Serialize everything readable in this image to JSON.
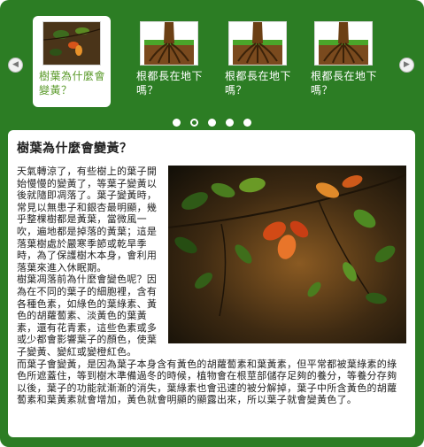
{
  "carousel": {
    "items": [
      {
        "caption": "樹葉為什麼會變黃？",
        "image": "autumn-leaves-thumbnail",
        "active": true
      },
      {
        "caption": "根都長在地下嗎？",
        "image": "tree-roots-thumbnail",
        "active": false
      },
      {
        "caption": "根都長在地下嗎？",
        "image": "tree-roots-thumbnail",
        "active": false
      },
      {
        "caption": "根都長在地下嗎？",
        "image": "tree-roots-thumbnail",
        "active": false
      }
    ],
    "prev_icon": "chevron-left-icon",
    "next_icon": "chevron-right-icon",
    "page_count": 5,
    "current_page": 2
  },
  "article": {
    "title": "樹葉為什麼會變黃？",
    "image": "autumn-leaves-photo",
    "paragraphs": [
      "天氣轉涼了，有些樹上的葉子開始慢慢的變黃了，等葉子變黃以後就隨即凋落了。葉子變黃時，常見以無患子和銀杏最明顯，幾乎整棵樹都是黃葉，當微風一吹，遍地都是掉落的黃葉；這是落葉樹處於嚴寒季節或乾旱季時，為了保護樹木本身，會利用落葉來進入休眠期。",
      "樹葉凋落前為什麼會變色呢？因為在不同的葉子的細胞裡，含有各種色素，如綠色的葉綠素、黃色的胡蘿蔔素、淡黃色的葉黃素，還有花青素，這些色素或多或少都會影響葉子的顏色，使葉子變黃、變紅或變橙紅色。",
      "而葉子會變黃，是因為葉子本身含有黃色的胡蘿蔔素和葉黃素，但平常都被葉綠素的綠色所遮蓋住，等到樹木準備過冬的時候，植物會在根莖部儲存足夠的養分，等養分存夠以後，葉子的功能就漸漸的消失，葉綠素也會迅速的被分解掉，葉子中所含黃色的胡蘿蔔素和葉黃素就會增加，黃色就會明顯的顯露出來，所以葉子就會變黃色了。"
    ]
  },
  "colors": {
    "frame_green": "#2c7d24",
    "active_caption": "#5a9a2a",
    "card": "#ffffff"
  }
}
